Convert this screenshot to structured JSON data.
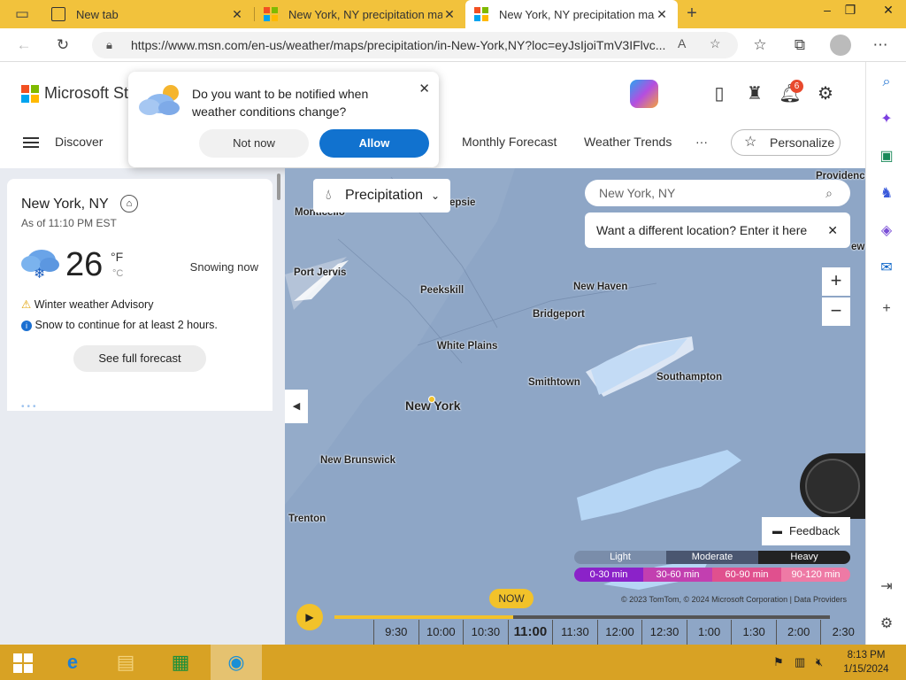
{
  "browser": {
    "tabs": [
      {
        "title": "New tab"
      },
      {
        "title": "New York, NY precipitation map"
      },
      {
        "title": "New York, NY precipitation map"
      }
    ],
    "url": "https://www.msn.com/en-us/weather/maps/precipitation/in-New-York,NY?loc=eyJsIjoiTmV3IFlvc..."
  },
  "header": {
    "brand": "Microsoft Sta",
    "nav": {
      "discover": "Discover",
      "monthly": "Monthly Forecast",
      "trends": "Weather Trends",
      "more": "···",
      "personalize": "Personalize"
    },
    "notification_count": "6"
  },
  "notification": {
    "question": "Do you want to be notified when weather conditions change?",
    "not_now": "Not now",
    "allow": "Allow"
  },
  "weather": {
    "city": "New York, NY",
    "as_of": "As of 11:10 PM EST",
    "temp": "26",
    "unit_f": "°F",
    "unit_c": "°C",
    "condition": "Snowing now",
    "advisory": "Winter weather Advisory",
    "snow_note": "Snow to continue for at least 2 hours.",
    "forecast_button": "See full forecast"
  },
  "map": {
    "layer": "Precipitation",
    "search_placeholder": "New York, NY",
    "tooltip": "Want a different location? Enter it here",
    "feedback": "Feedback",
    "labels": {
      "providence": "Providence",
      "monticello": "Monticello",
      "poughkeepsie": "epsie",
      "port_jervis": "Port Jervis",
      "peekskill": "Peekskill",
      "new_haven": "New Haven",
      "bridgeport": "Bridgeport",
      "white_plains": "White Plains",
      "smithtown": "Smithtown",
      "southampton": "Southampton",
      "new_york": "New York",
      "new_brunswick": "New Brunswick",
      "trenton": "Trenton",
      "ew": "ew"
    },
    "legend": {
      "intensity": [
        "Light",
        "Moderate",
        "Heavy"
      ],
      "duration": [
        "0-30 min",
        "30-60 min",
        "60-90 min",
        "90-120 min"
      ],
      "duration_colors": [
        "#8b22c9",
        "#c23fb0",
        "#e0508e",
        "#ee7aa5"
      ]
    },
    "copyright": "© 2023 TomTom, © 2024 Microsoft Corporation | Data Providers",
    "timeline": {
      "now_label": "NOW",
      "times": [
        "9:30",
        "10:00",
        "10:30",
        "11:00",
        "11:30",
        "12:00",
        "12:30",
        "1:00",
        "1:30",
        "2:00",
        "2:30"
      ],
      "current": "11:00",
      "progress": 0.36
    }
  },
  "taskbar": {
    "time": "8:13 PM",
    "date": "1/15/2024"
  }
}
